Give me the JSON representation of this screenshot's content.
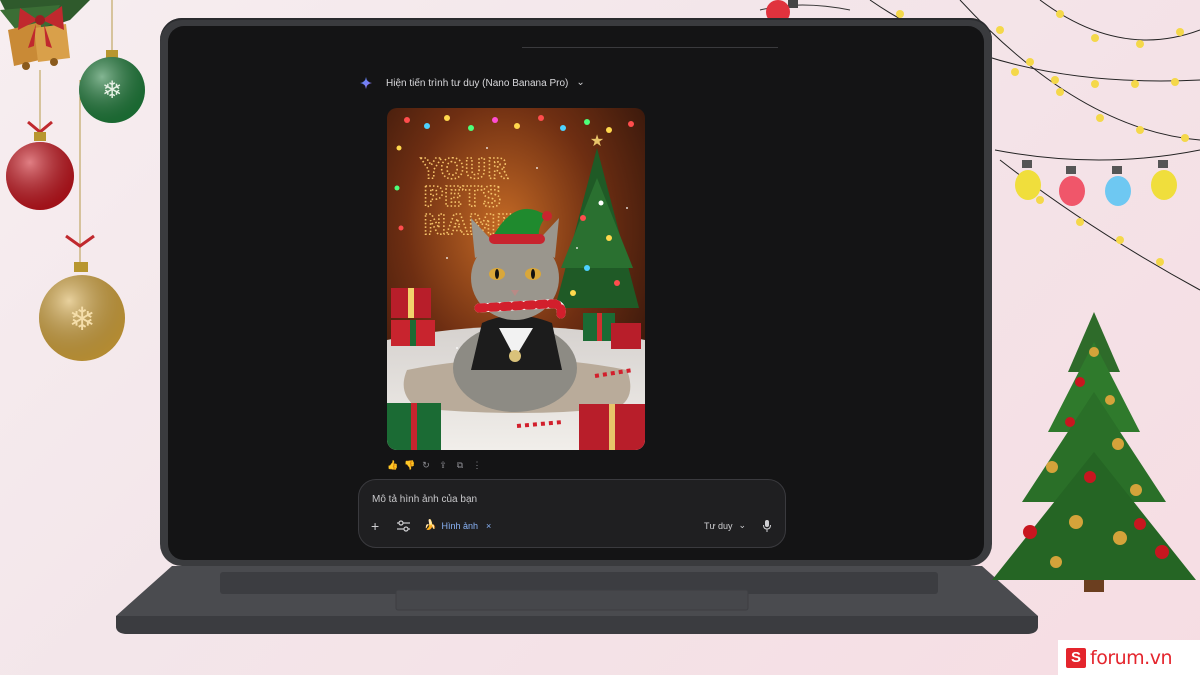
{
  "thinking_header": {
    "label": "Hiện tiến trình tư duy (Nano Banana Pro)",
    "icon": "gemini-spark-icon",
    "toggle_icon": "chevron-down-icon"
  },
  "generated_image": {
    "overlay_text_lines": [
      "YOUR",
      "PETS",
      "NAME"
    ],
    "icons": [
      "star-icon"
    ]
  },
  "response_actions": [
    {
      "name": "thumbs-up-icon",
      "glyph": "👍"
    },
    {
      "name": "thumbs-down-icon",
      "glyph": "👎"
    },
    {
      "name": "regenerate-icon",
      "glyph": "↻"
    },
    {
      "name": "share-icon",
      "glyph": "⇪"
    },
    {
      "name": "copy-icon",
      "glyph": "⧉"
    },
    {
      "name": "more-icon",
      "glyph": "⋮"
    }
  ],
  "prompt": {
    "placeholder": "Mô tả hình ảnh của bạn",
    "add_icon": "plus-icon",
    "tools_icon": "tools-icon",
    "chip_label": "Hình ảnh",
    "chip_icon": "banana-icon",
    "chip_close": "×",
    "mode_label": "Tư duy",
    "mode_icon": "chevron-down-icon",
    "mic_icon": "mic-icon"
  },
  "brand": {
    "logo_mark": "S",
    "logo_text": "forum.vn",
    "color": "#e4252d"
  },
  "colors": {
    "screen_bg": "#141415",
    "accent_blue": "#8ab4f8",
    "laptop_body": "#3a3b3e"
  }
}
